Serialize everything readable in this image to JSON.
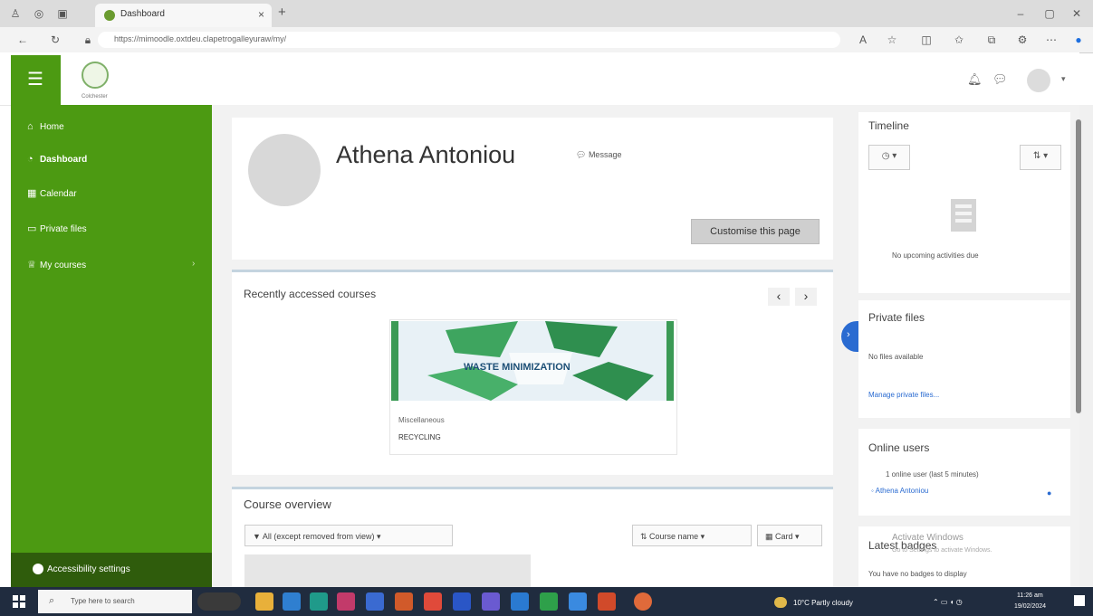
{
  "browser": {
    "tab_title": "Dashboard",
    "url": "https://mimoodle.oxtdeu.clapetrogalleyuraw/my/"
  },
  "header": {
    "logo_text": "Colchester"
  },
  "drawer": {
    "items": [
      {
        "label": "Home",
        "icon": "home-icon"
      },
      {
        "label": "Dashboard",
        "icon": "dashboard-icon"
      },
      {
        "label": "Calendar",
        "icon": "calendar-icon"
      },
      {
        "label": "Private files",
        "icon": "file-icon"
      },
      {
        "label": "My courses",
        "icon": "graduation-cap-icon"
      }
    ],
    "footer_label": "Accessibility settings"
  },
  "profile": {
    "name": "Athena Antoniou",
    "message_label": "Message",
    "customise_label": "Customise this page"
  },
  "recent": {
    "title": "Recently accessed courses",
    "course": {
      "image_title": "WASTE MINIMIZATION",
      "category": "Miscellaneous",
      "name": "RECYCLING"
    }
  },
  "overview": {
    "title": "Course overview",
    "filter_label": "All (except removed from view)",
    "sort_label": "Course name",
    "view_label": "Card"
  },
  "blocks": {
    "timeline": {
      "title": "Timeline",
      "empty": "No upcoming activities due"
    },
    "private_files": {
      "title": "Private files",
      "empty": "No files available",
      "manage": "Manage private files..."
    },
    "online_users": {
      "title": "Online users",
      "count": "1 online user (last 5 minutes)",
      "user": "Athena Antoniou"
    },
    "latest_badges": {
      "title": "Latest badges",
      "empty": "You have no badges to display"
    }
  },
  "watermark": {
    "line1": "Activate Windows",
    "line2": "Go to Settings to activate Windows."
  },
  "taskbar": {
    "search_placeholder": "Type here to search",
    "weather": "10°C Partly cloudy",
    "time": "11:26 am",
    "date": "19/02/2024"
  },
  "colors": {
    "drawer_green": "#4c9a12",
    "drawer_footer": "#2f5c0c",
    "toggle_blue": "#2a6bd1"
  }
}
